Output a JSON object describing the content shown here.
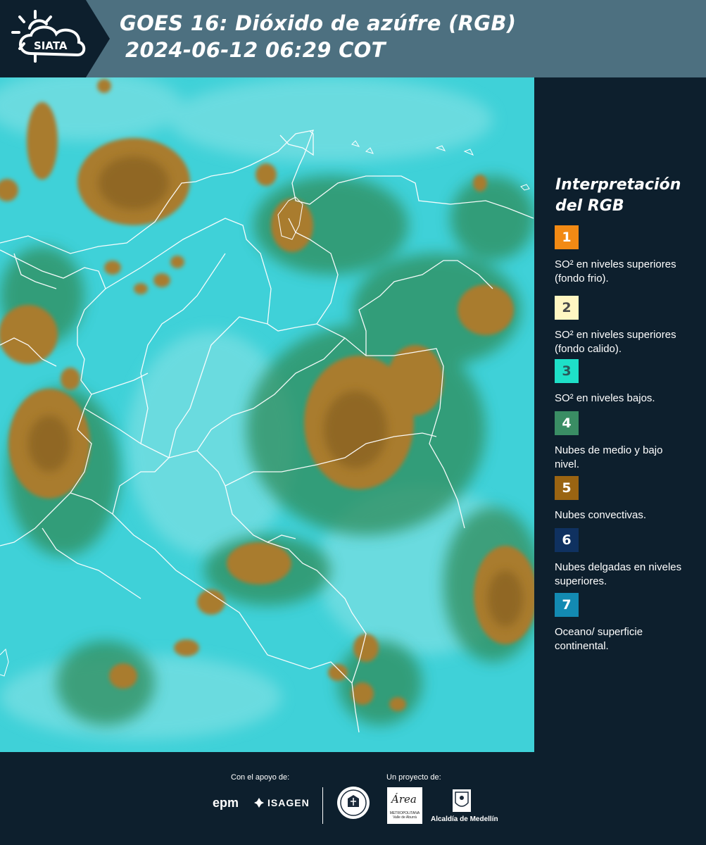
{
  "header": {
    "logo_text": "SIATA",
    "title_line1": "GOES 16: Dióxido de azúfre (RGB)",
    "title_line2": "2024-06-12 06:29 COT"
  },
  "colors": {
    "ocean_cyan": "#3fd1d8",
    "convective_brown": "#a97b2e",
    "mid_low_green": "#2f8c5a",
    "background_navy": "#0d1f2d",
    "header_band": "#4d7080",
    "border_white": "#ffffff"
  },
  "legend": {
    "title": "Interpretación del RGB",
    "items": [
      {
        "number": "1",
        "color": "#f28a14",
        "number_color": "#ffffff",
        "text": "SO² en niveles superiores (fondo frio)."
      },
      {
        "number": "2",
        "color": "#fff6c2",
        "number_color": "#4a4a4a",
        "text": "SO² en niveles superiores (fondo calido)."
      },
      {
        "number": "3",
        "color": "#1ee0c8",
        "number_color": "#2a5a5a",
        "text": "SO² en niveles bajos."
      },
      {
        "number": "4",
        "color": "#3a8d64",
        "number_color": "#ffffff",
        "text": "Nubes de medio y bajo nivel."
      },
      {
        "number": "5",
        "color": "#9a6412",
        "number_color": "#ffffff",
        "text": "Nubes convectivas."
      },
      {
        "number": "6",
        "color": "#0f3160",
        "number_color": "#ffffff",
        "text": "Nubes delgadas en niveles superiores."
      },
      {
        "number": "7",
        "color": "#138ab2",
        "number_color": "#ffffff",
        "text": "Oceano/ superficie continental."
      }
    ]
  },
  "footer": {
    "support_label": "Con el apoyo de:",
    "project_label": "Un proyecto de:",
    "epm": "epm",
    "isagen": "ISAGEN",
    "area_word": "Área",
    "area_sub": "METROPOLITANA Valle de Aburrá",
    "alcaldia": "Alcaldía de Medellín"
  }
}
